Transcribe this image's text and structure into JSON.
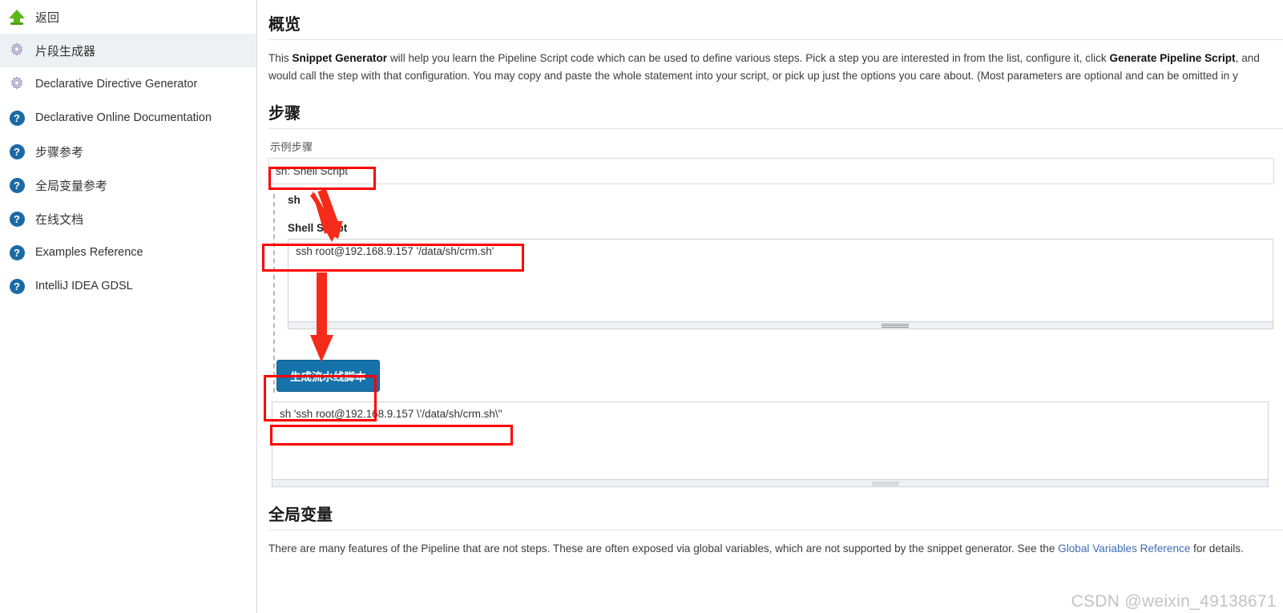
{
  "sidebar": {
    "items": [
      {
        "label": "返回",
        "icon": "arrow-up-icon",
        "active": false
      },
      {
        "label": "片段生成器",
        "icon": "gear-icon",
        "active": true
      },
      {
        "label": "Declarative Directive Generator",
        "icon": "gear-icon",
        "active": false
      },
      {
        "label": "Declarative Online Documentation",
        "icon": "help-icon",
        "active": false
      },
      {
        "label": "步骤参考",
        "icon": "help-icon",
        "active": false
      },
      {
        "label": "全局变量参考",
        "icon": "help-icon",
        "active": false
      },
      {
        "label": "在线文档",
        "icon": "help-icon",
        "active": false
      },
      {
        "label": "Examples Reference",
        "icon": "help-icon",
        "active": false
      },
      {
        "label": "IntelliJ IDEA GDSL",
        "icon": "help-icon",
        "active": false
      }
    ]
  },
  "overview": {
    "heading": "概览",
    "paragraph_line1_pre": "This ",
    "paragraph_line1_bold1": "Snippet Generator",
    "paragraph_line1_mid": " will help you learn the Pipeline Script code which can be used to define various steps. Pick a step you are interested in from the list, configure it, click ",
    "paragraph_line1_bold2": "Generate Pipeline Script",
    "paragraph_line1_post": ", and",
    "paragraph_line2": "would call the step with that configuration. You may copy and paste the whole statement into your script, or pick up just the options you care about. (Most parameters are optional and can be omitted in y"
  },
  "steps": {
    "heading": "步骤",
    "sample_step_label": "示例步骤",
    "selected_step": "sh: Shell Script",
    "step_options": [
      "sh: Shell Script"
    ],
    "step_name": "sh",
    "script_field_label": "Shell Script",
    "script_value": "ssh root@192.168.9.157 '/data/sh/crm.sh'",
    "generate_button": "生成流水线脚本",
    "generated_script": "sh 'ssh root@192.168.9.157 \\'/data/sh/crm.sh\\''"
  },
  "globals": {
    "heading": "全局变量",
    "paragraph_pre": "There are many features of the Pipeline that are not steps. These are often exposed via global variables, which are not supported by the snippet generator. See the ",
    "link_text": "Global Variables Reference",
    "paragraph_post": " for details."
  },
  "watermark": "CSDN @weixin_49138671",
  "colors": {
    "accent": "#1572aa",
    "annotation": "#ff0000",
    "arrow_green": "#5ab715",
    "help_blue": "#1b6aa5",
    "link": "#3c6eb4"
  }
}
